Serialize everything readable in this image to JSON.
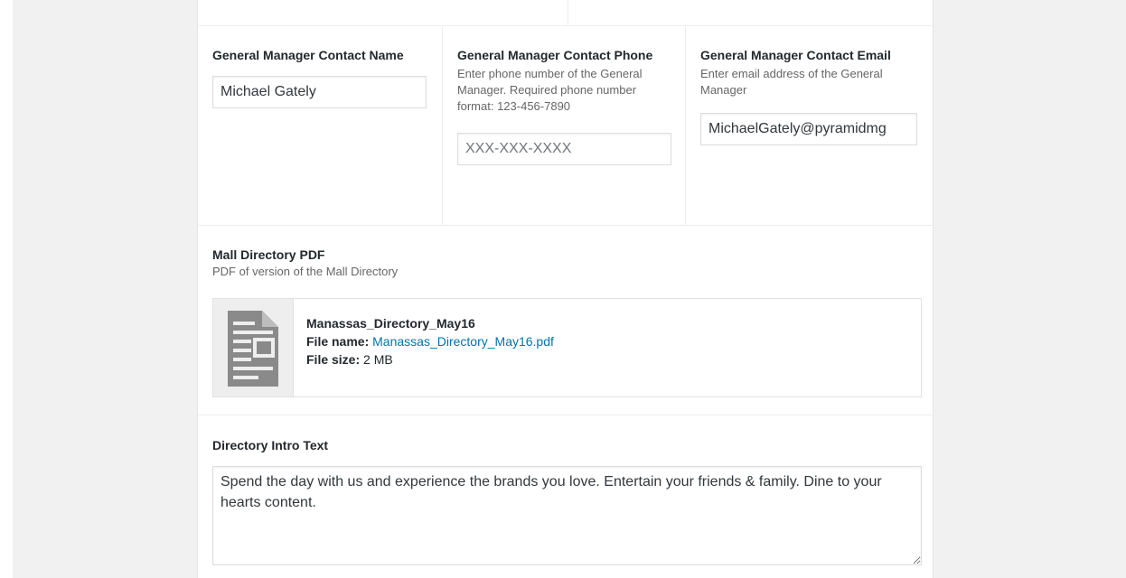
{
  "general_manager": {
    "name": {
      "label": "General Manager Contact Name",
      "value": "Michael Gately"
    },
    "phone": {
      "label": "General Manager Contact Phone",
      "description": "Enter phone number of the General Manager. Required phone number format: 123-456-7890",
      "value": "",
      "placeholder": "XXX-XXX-XXXX"
    },
    "email": {
      "label": "General Manager Contact Email",
      "description": "Enter email address of the General Manager",
      "value": "MichaelGately@pyramidmg"
    }
  },
  "mall_directory": {
    "label": "Mall Directory PDF",
    "description": "PDF of version of the Mall Directory",
    "file": {
      "icon": "document-icon",
      "title": "Manassas_Directory_May16",
      "file_name_label": "File name:",
      "file_name": "Manassas_Directory_May16.pdf",
      "file_size_label": "File size:",
      "file_size": "2 MB"
    }
  },
  "directory_intro": {
    "label": "Directory Intro Text",
    "value": "Spend the day with us and experience the brands you love. Entertain your friends & family. Dine to your hearts content."
  }
}
